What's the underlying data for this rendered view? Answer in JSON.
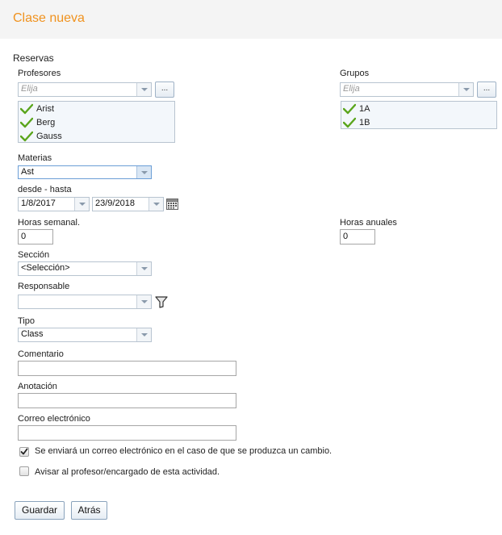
{
  "header": {
    "title": "Clase nueva"
  },
  "reservas": {
    "label": "Reservas",
    "profesores": {
      "label": "Profesores",
      "placeholder": "Elija",
      "browse_label": "...",
      "items": [
        "Arist",
        "Berg",
        "Gauss"
      ]
    },
    "grupos": {
      "label": "Grupos",
      "placeholder": "Elija",
      "browse_label": "...",
      "items": [
        "1A",
        "1B"
      ]
    }
  },
  "materias": {
    "label": "Materias",
    "value": "Ast"
  },
  "periodo": {
    "label": "desde - hasta",
    "from": "1/8/2017",
    "to": "23/9/2018"
  },
  "horas_semanal": {
    "label": "Horas semanal.",
    "value": "0"
  },
  "horas_anuales": {
    "label": "Horas anuales",
    "value": "0"
  },
  "seccion": {
    "label": "Sección",
    "value": "<Selección>"
  },
  "responsable": {
    "label": "Responsable",
    "value": ""
  },
  "tipo": {
    "label": "Tipo",
    "value": "Class"
  },
  "comentario": {
    "label": "Comentario",
    "value": ""
  },
  "anotacion": {
    "label": "Anotación",
    "value": ""
  },
  "correo": {
    "label": "Correo electrónico",
    "value": ""
  },
  "options": {
    "email_on_change": {
      "label": "Se enviará un correo electrónico en el caso de que se produzca un cambio.",
      "checked": true
    },
    "notify_teacher": {
      "label": "Avisar al profesor/encargado de esta actividad.",
      "checked": false
    }
  },
  "buttons": {
    "save": "Guardar",
    "back": "Atrás"
  },
  "colors": {
    "title": "#f0921e",
    "check": "#5aa51c",
    "header_bg": "#f4f4f4"
  },
  "icons": [
    "check-icon",
    "calendar-icon",
    "filter-icon",
    "dropdown-arrow-icon"
  ]
}
